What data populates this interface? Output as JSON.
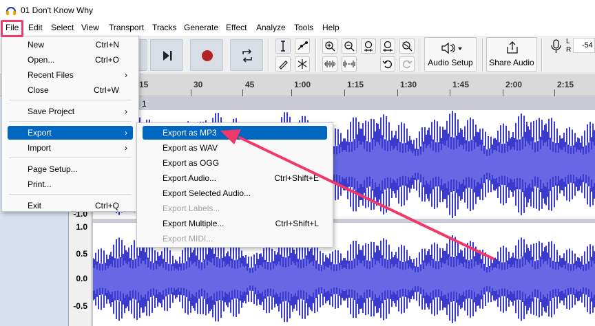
{
  "window": {
    "title": "01 Don't Know Why"
  },
  "menubar": {
    "items": [
      "File",
      "Edit",
      "Select",
      "View",
      "Transport",
      "Tracks",
      "Generate",
      "Effect",
      "Analyze",
      "Tools",
      "Help"
    ]
  },
  "toolbar": {
    "audio_setup_label": "Audio Setup",
    "share_audio_label": "Share Audio",
    "meter_value": "-54",
    "meter_left": "L",
    "meter_right": "R"
  },
  "timeline": {
    "ticks": [
      "15",
      "30",
      "45",
      "1:00",
      "1:15",
      "1:30",
      "1:45",
      "2:00",
      "2:15"
    ]
  },
  "track": {
    "clip_name": "p 1",
    "upper_ruler": [
      "-1.0"
    ],
    "lower_ruler": [
      "1.0",
      "0.5",
      "0.0",
      "-0.5"
    ]
  },
  "file_menu": {
    "items": [
      {
        "label": "New",
        "shortcut": "Ctrl+N"
      },
      {
        "label": "Open...",
        "shortcut": "Ctrl+O"
      },
      {
        "label": "Recent Files",
        "submenu": true
      },
      {
        "label": "Close",
        "shortcut": "Ctrl+W"
      },
      {
        "label": "Save Project",
        "submenu": true
      },
      {
        "label": "Export",
        "submenu": true,
        "highlighted": true
      },
      {
        "label": "Import",
        "submenu": true
      },
      {
        "label": "Page Setup..."
      },
      {
        "label": "Print..."
      },
      {
        "label": "Exit",
        "shortcut": "Ctrl+Q"
      }
    ]
  },
  "export_submenu": {
    "items": [
      {
        "label": "Export as MP3",
        "highlighted": true
      },
      {
        "label": "Export as WAV"
      },
      {
        "label": "Export as OGG"
      },
      {
        "label": "Export Audio...",
        "shortcut": "Ctrl+Shift+E"
      },
      {
        "label": "Export Selected Audio..."
      },
      {
        "label": "Export Labels...",
        "disabled": true
      },
      {
        "label": "Export Multiple...",
        "shortcut": "Ctrl+Shift+L"
      },
      {
        "label": "Export MIDI...",
        "disabled": true
      }
    ]
  },
  "colors": {
    "accent": "#0067c0",
    "annotation": "#f0396a",
    "waveform": "#3a3acd",
    "waveform_rms": "#6868e4",
    "track_background": "#c9ccd7"
  }
}
